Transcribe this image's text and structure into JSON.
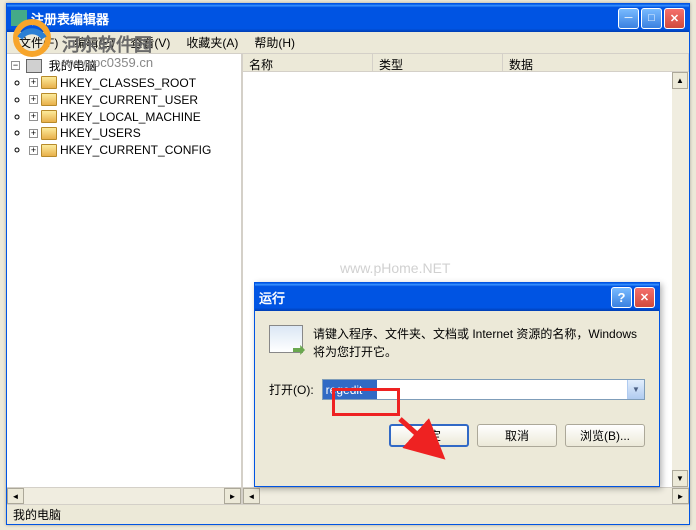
{
  "main_window": {
    "title": "注册表编辑器",
    "menu": {
      "file": "文件(F)",
      "edit": "编辑(E)",
      "view": "查看(V)",
      "favorites": "收藏夹(A)",
      "help": "帮助(H)"
    },
    "columns": {
      "name": "名称",
      "type": "类型",
      "data": "数据"
    },
    "tree": {
      "root": "我的电脑",
      "keys": [
        "HKEY_CLASSES_ROOT",
        "HKEY_CURRENT_USER",
        "HKEY_LOCAL_MACHINE",
        "HKEY_USERS",
        "HKEY_CURRENT_CONFIG"
      ]
    },
    "statusbar": "我的电脑"
  },
  "run_dialog": {
    "title": "运行",
    "message": "请键入程序、文件夹、文档或 Internet 资源的名称，Windows 将为您打开它。",
    "open_label": "打开(O):",
    "input_value": "regedit",
    "buttons": {
      "ok": "确定",
      "cancel": "取消",
      "browse": "浏览(B)..."
    }
  },
  "watermark": {
    "site_name": "河东软件园",
    "url": "www.pc0359.cn",
    "center": "www.pHome.NET"
  }
}
